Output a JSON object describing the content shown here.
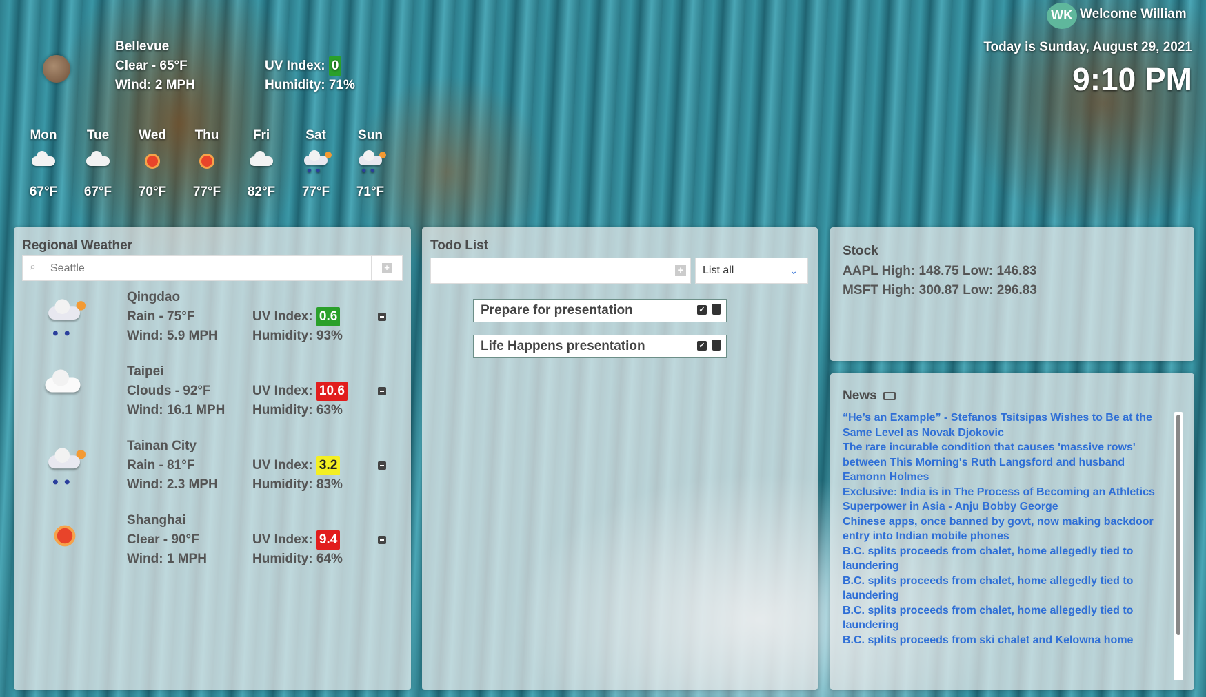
{
  "user": {
    "initials": "WK",
    "welcome": "Welcome William"
  },
  "datetime": {
    "date_line": "Today is Sunday, August 29, 2021",
    "time": "9:10 PM"
  },
  "current": {
    "city": "Bellevue",
    "condition": "Clear - 65°F",
    "wind": "Wind: 2 MPH",
    "uv_label": "UV Index:",
    "uv_value": "0",
    "humidity": "Humidity: 71%"
  },
  "forecast": [
    {
      "day": "Mon",
      "temp": "67°F",
      "icon": "cloud-moon-icon"
    },
    {
      "day": "Tue",
      "temp": "67°F",
      "icon": "cloud-icon"
    },
    {
      "day": "Wed",
      "temp": "70°F",
      "icon": "sun-icon"
    },
    {
      "day": "Thu",
      "temp": "77°F",
      "icon": "sun-icon"
    },
    {
      "day": "Fri",
      "temp": "82°F",
      "icon": "cloud-moon-icon"
    },
    {
      "day": "Sat",
      "temp": "77°F",
      "icon": "rain-icon"
    },
    {
      "day": "Sun",
      "temp": "71°F",
      "icon": "rain-icon"
    }
  ],
  "regional": {
    "title": "Regional Weather",
    "search_placeholder": "Seattle",
    "cities": [
      {
        "name": "Qingdao",
        "condition": "Rain - 75°F",
        "wind": "Wind: 5.9 MPH",
        "uv_label": "UV Index:",
        "uv": "0.6",
        "uv_color": "#2aa02a",
        "humidity": "Humidity: 93%",
        "icon": "rain-icon"
      },
      {
        "name": "Taipei",
        "condition": "Clouds - 92°F",
        "wind": "Wind: 16.1 MPH",
        "uv_label": "UV Index:",
        "uv": "10.6",
        "uv_color": "#e11d1d",
        "humidity": "Humidity: 63%",
        "icon": "cloud-icon"
      },
      {
        "name": "Tainan City",
        "condition": "Rain - 81°F",
        "wind": "Wind: 2.3 MPH",
        "uv_label": "UV Index:",
        "uv": "3.2",
        "uv_color": "#f4ef22",
        "humidity": "Humidity: 83%",
        "icon": "rain-icon"
      },
      {
        "name": "Shanghai",
        "condition": "Clear - 90°F",
        "wind": "Wind: 1 MPH",
        "uv_label": "UV Index:",
        "uv": "9.4",
        "uv_color": "#e11d1d",
        "humidity": "Humidity: 64%",
        "icon": "sun-icon"
      }
    ]
  },
  "todo": {
    "title": "Todo List",
    "input_value": "",
    "filter": "List all",
    "items": [
      "Prepare for presentation",
      "Life Happens presentation"
    ]
  },
  "stock": {
    "title": "Stock",
    "lines": [
      "AAPL High: 148.75 Low: 146.83",
      "MSFT High: 300.87 Low: 296.83"
    ]
  },
  "news": {
    "title": "News",
    "items": [
      "“He’s an Example” - Stefanos Tsitsipas Wishes to Be at the Same Level as Novak Djokovic",
      "The rare incurable condition that causes 'massive rows' between This Morning's Ruth Langsford and husband Eamonn Holmes",
      "Exclusive: India is in The Process of Becoming an Athletics Superpower in Asia - Anju Bobby George",
      "Chinese apps, once banned by govt, now making backdoor entry into Indian mobile phones",
      "B.C. splits proceeds from chalet, home allegedly tied to laundering",
      "B.C. splits proceeds from chalet, home allegedly tied to laundering",
      "B.C. splits proceeds from chalet, home allegedly tied to laundering",
      "B.C. splits proceeds from ski chalet and Kelowna home"
    ]
  }
}
